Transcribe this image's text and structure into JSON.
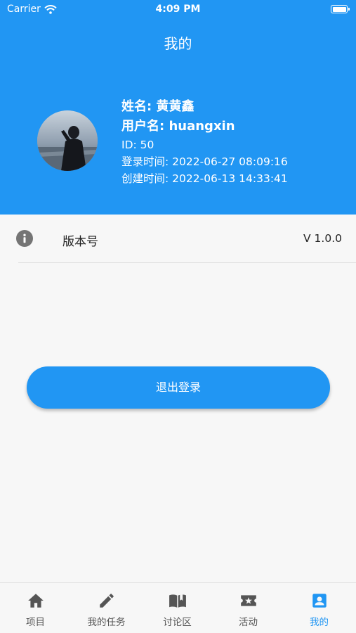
{
  "status_bar": {
    "carrier": "Carrier",
    "time": "4:09 PM"
  },
  "header": {
    "title": "我的"
  },
  "profile": {
    "name_line": "姓名: 黄黄鑫",
    "username_line": "用户名: huangxin",
    "id_line": "ID: 50",
    "login_time_line": "登录时间: 2022-06-27 08:09:16",
    "created_time_line": "创建时间: 2022-06-13 14:33:41"
  },
  "settings": {
    "version_label": "版本号",
    "version_value": "V 1.0.0"
  },
  "logout_label": "退出登录",
  "tabs": [
    {
      "label": "项目",
      "icon": "home-icon"
    },
    {
      "label": "我的任务",
      "icon": "pencil-icon"
    },
    {
      "label": "讨论区",
      "icon": "book-icon"
    },
    {
      "label": "活动",
      "icon": "ticket-star-icon"
    },
    {
      "label": "我的",
      "icon": "account-box-icon",
      "active": true
    }
  ],
  "colors": {
    "primary": "#2196f3",
    "icon_gray": "#555555",
    "background": "#f7f7f7"
  }
}
